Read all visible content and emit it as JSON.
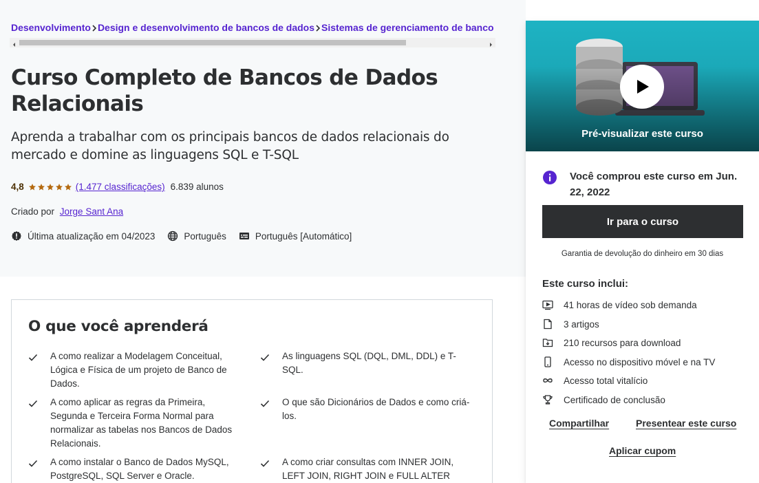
{
  "breadcrumb": {
    "items": [
      {
        "label": "Desenvolvimento"
      },
      {
        "label": "Design e desenvolvimento de bancos de dados"
      },
      {
        "label": "Sistemas de gerenciamento de banco de dados"
      }
    ]
  },
  "course": {
    "title": "Curso Completo de Bancos de Dados Relacionais",
    "headline": "Aprenda a trabalhar com os principais bancos de dados relacionais do mercado e domine as linguagens SQL e T-SQL",
    "rating": "4,8",
    "stars_filled": 5,
    "rating_count": "(1.477 classificações)",
    "students": "6.839 alunos",
    "created_by_label": "Criado por",
    "instructor": "Jorge Sant Ana",
    "last_updated": "Última atualização em 04/2023",
    "language": "Português",
    "captions": "Português [Automático]"
  },
  "learn": {
    "title": "O que você aprenderá",
    "items": [
      "A como realizar a Modelagem Conceitual, Lógica e Física de um projeto de Banco de Dados.",
      "As linguagens SQL (DQL, DML, DDL) e T-SQL.",
      "A como aplicar as regras da Primeira, Segunda e Terceira Forma Normal para normalizar as tabelas nos Bancos de Dados Relacionais.",
      "O que são Dicionários de Dados e como criá-los.",
      "A como instalar o Banco de Dados MySQL, PostgreSQL, SQL Server e Oracle.",
      "A como criar consultas com INNER JOIN, LEFT JOIN, RIGHT JOIN e FULL ALTER JOIN."
    ]
  },
  "sidebar": {
    "preview_label": "Pré-visualizar este curso",
    "purchased_text": "Você comprou este curso em Jun. 22, 2022",
    "go_button": "Ir para o curso",
    "guarantee": "Garantia de devolução do dinheiro em 30 dias",
    "includes_title": "Este curso inclui:",
    "includes": [
      {
        "icon": "video-icon",
        "label": "41 horas de vídeo sob demanda"
      },
      {
        "icon": "file-icon",
        "label": "3 artigos"
      },
      {
        "icon": "download-icon",
        "label": "210 recursos para download"
      },
      {
        "icon": "mobile-icon",
        "label": "Acesso no dispositivo móvel e na TV"
      },
      {
        "icon": "infinity-icon",
        "label": "Acesso total vitalício"
      },
      {
        "icon": "trophy-icon",
        "label": "Certificado de conclusão"
      }
    ],
    "share": "Compartilhar",
    "gift": "Presentear este curso",
    "coupon": "Aplicar cupom"
  },
  "colors": {
    "link": "#5624d0",
    "text": "#2d2f31",
    "star": "#b4690e",
    "button_dark": "#2d2f31",
    "preview_teal": "#1eb3c3"
  }
}
